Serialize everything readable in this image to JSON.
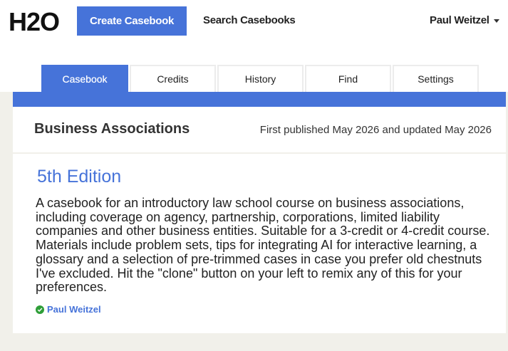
{
  "header": {
    "logo": "H2O",
    "create_label": "Create Casebook",
    "search_label": "Search Casebooks",
    "user_name": "Paul Weitzel"
  },
  "tabs": [
    {
      "label": "Casebook",
      "active": true
    },
    {
      "label": "Credits",
      "active": false
    },
    {
      "label": "History",
      "active": false
    },
    {
      "label": "Find",
      "active": false
    },
    {
      "label": "Settings",
      "active": false
    }
  ],
  "casebook": {
    "title": "Business Associations",
    "published": "First published May 2026 and updated May 2026",
    "edition": "5th Edition",
    "description": "A casebook for an introductory law school course on business associations, including coverage on agency, partnership, corporations, limited liability companies and other business entities. Suitable for a 3-credit or 4-credit course. Materials include problem sets, tips for integrating AI for interactive learning, a glossary and a selection of pre-trimmed cases in case you prefer old chestnuts I've excluded. Hit the \"clone\" button on your left to remix any of this for your preferences.",
    "author": "Paul Weitzel",
    "author_verified_icon": "check-circle-icon"
  },
  "colors": {
    "accent": "#4673d9",
    "background": "#f1f0ea",
    "verified": "#2e9e38"
  }
}
